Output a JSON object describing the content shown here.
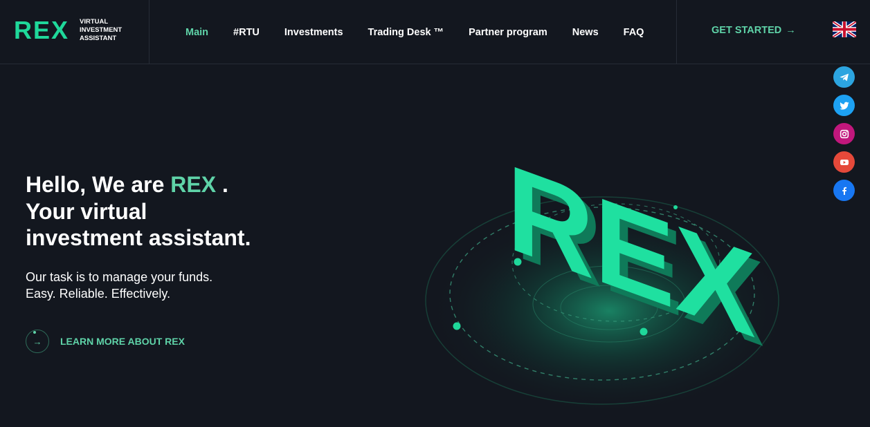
{
  "logo": {
    "word": "REX",
    "tagline": [
      "VIRTUAL",
      "INVESTMENT",
      "ASSISTANT"
    ]
  },
  "nav": {
    "items": [
      {
        "label": "Main",
        "active": true
      },
      {
        "label": "#RTU"
      },
      {
        "label": "Investments"
      },
      {
        "label": "Trading Desk ™"
      },
      {
        "label": "Partner program"
      },
      {
        "label": "News"
      },
      {
        "label": "FAQ"
      }
    ]
  },
  "cta": {
    "label": "GET STARTED",
    "arrow": "→"
  },
  "language": {
    "flag": "uk-flag-icon"
  },
  "socials": [
    {
      "name": "telegram-icon",
      "color": "#2ca5e0"
    },
    {
      "name": "twitter-icon",
      "color": "#1da1f2"
    },
    {
      "name": "instagram-icon",
      "color": "#c1177c"
    },
    {
      "name": "youtube-icon",
      "color": "#e5493a"
    },
    {
      "name": "facebook-icon",
      "color": "#1877f2"
    }
  ],
  "hero": {
    "title_pre": "Hello, We are ",
    "title_accent": "REX",
    "title_post": " .",
    "title_line2": "Your virtual",
    "title_line3": "investment assistant.",
    "subtitle_line1": "Our task is to manage your funds.",
    "subtitle_line2": "Easy. Reliable. Effectively.",
    "learn_more": "LEARN MORE ABOUT REX",
    "learn_arrow": "→"
  },
  "art": {
    "word": "REX"
  },
  "colors": {
    "background": "#13171f",
    "accent": "#1fd89a",
    "accent_text": "#5fd3a8"
  }
}
